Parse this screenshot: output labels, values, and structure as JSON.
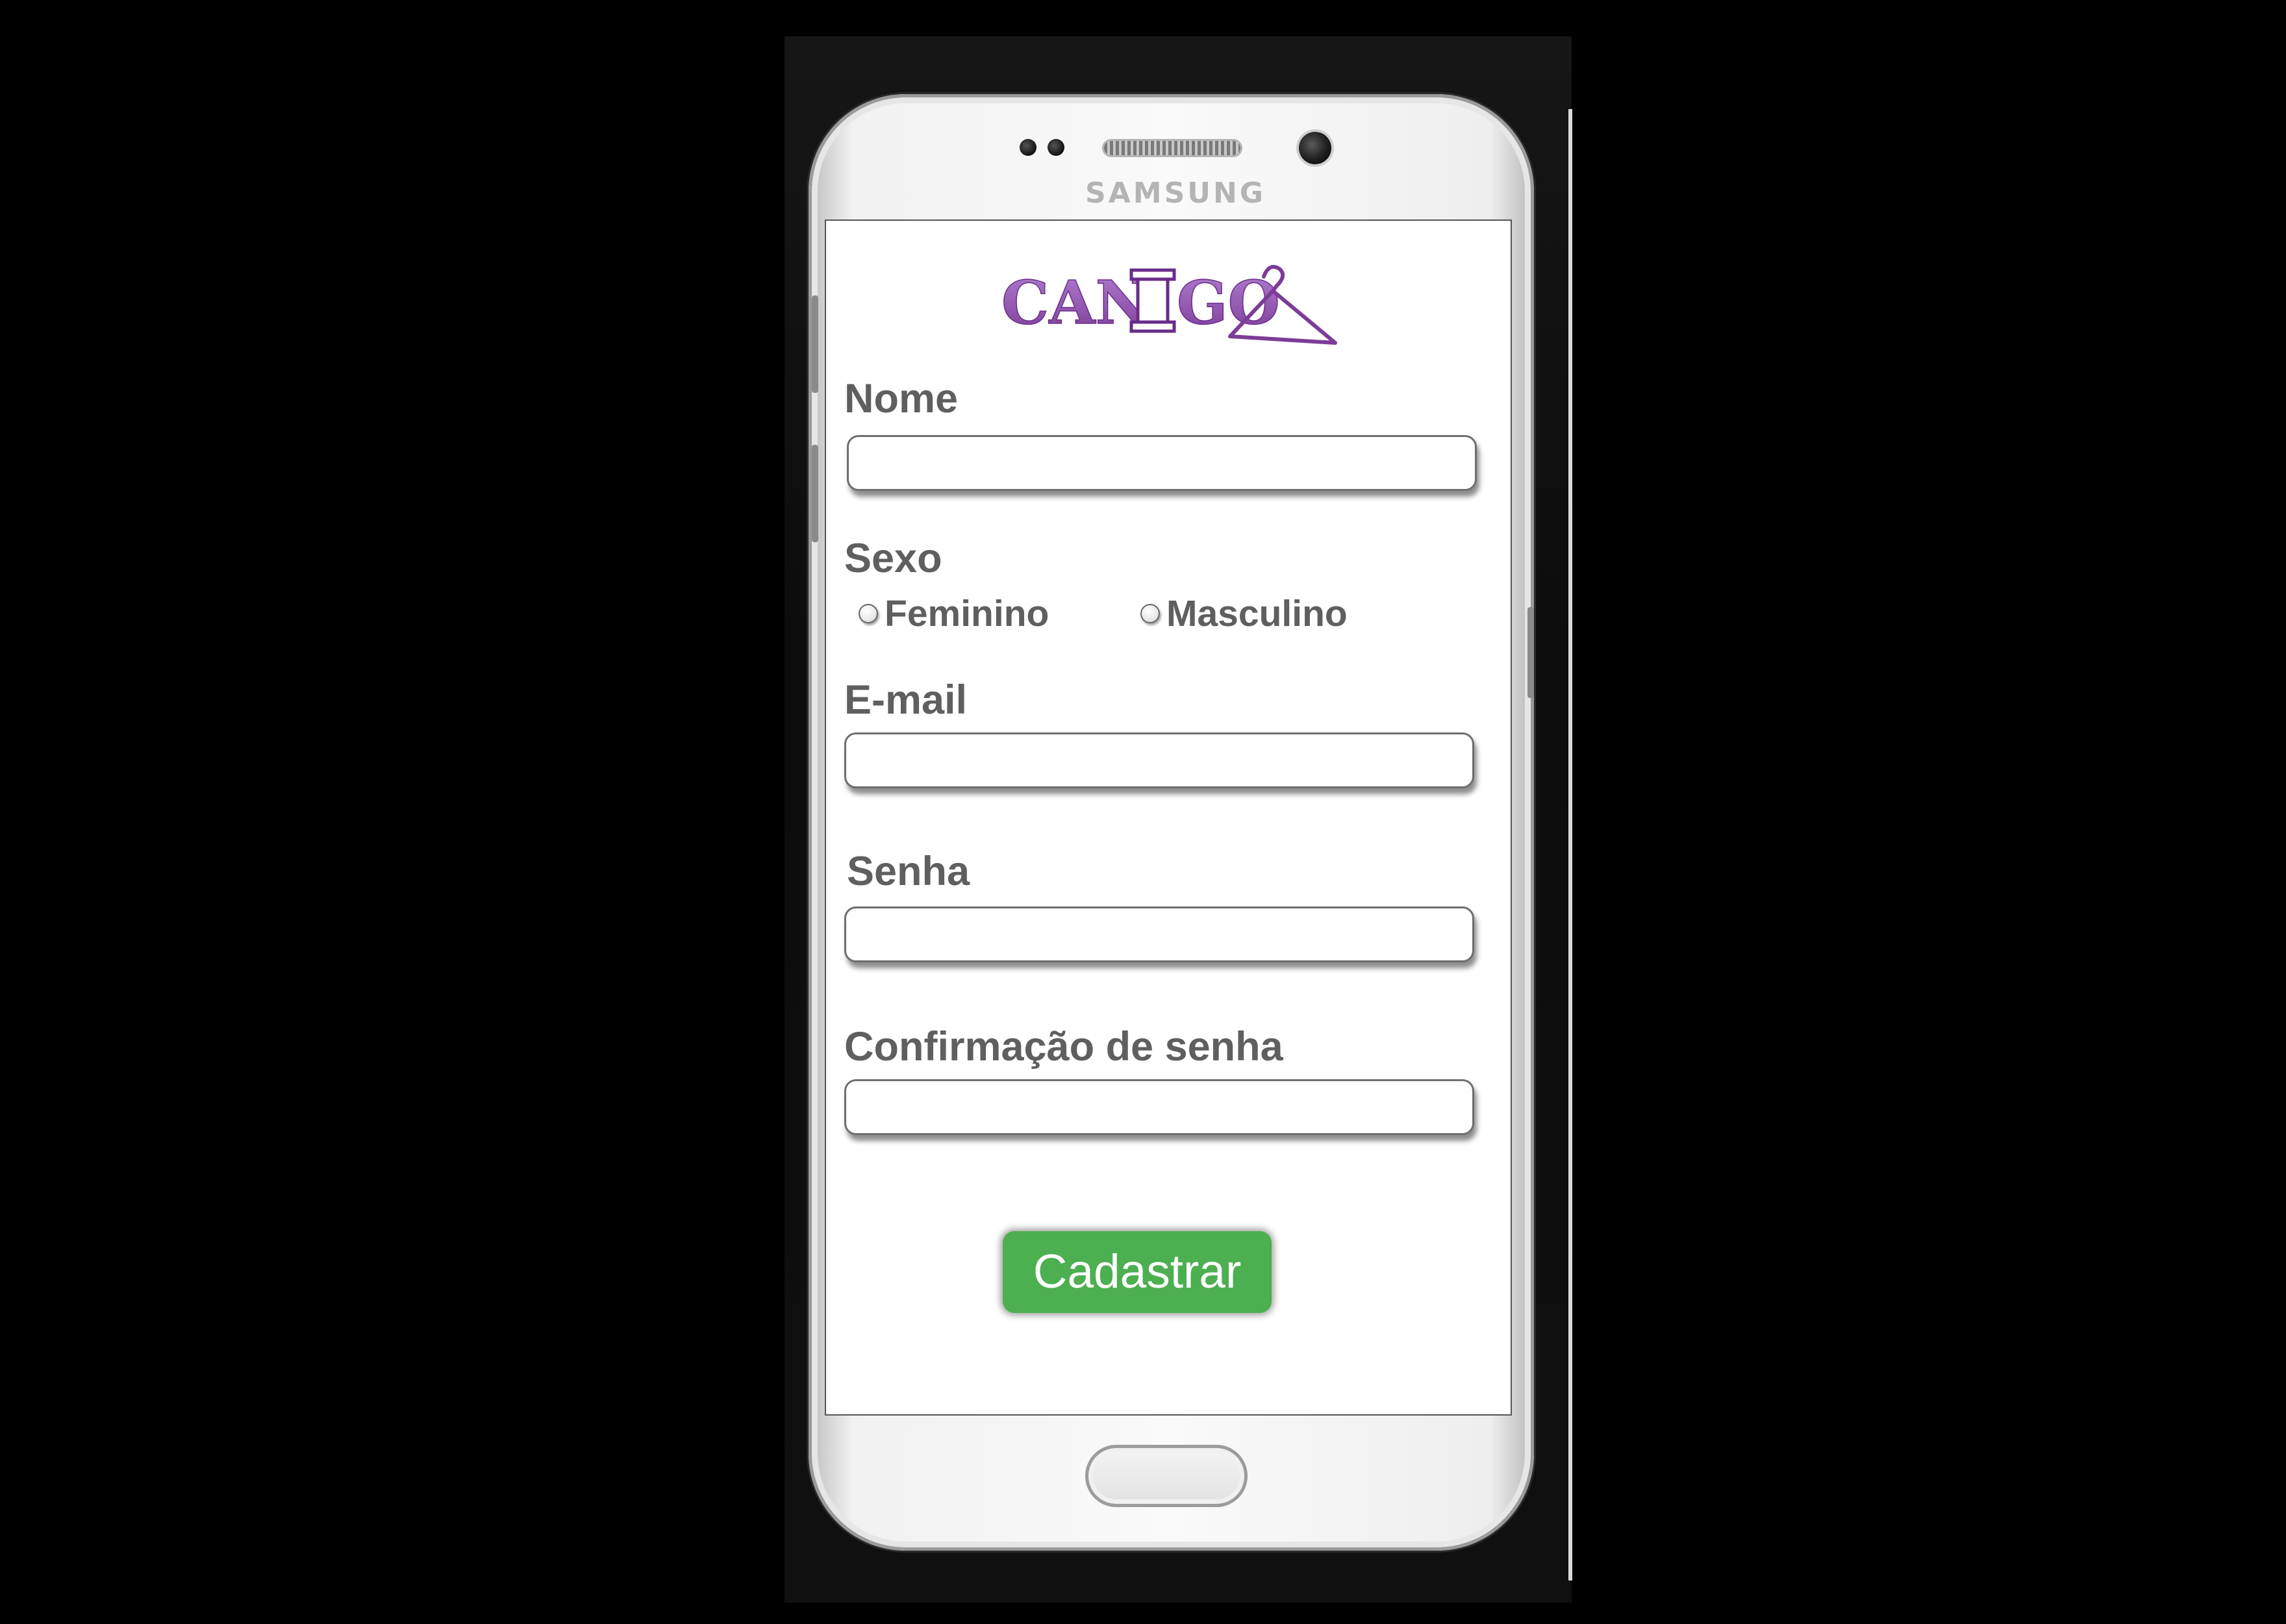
{
  "device": {
    "brand": "SAMSUNG"
  },
  "app": {
    "logo_text": "CANIGO",
    "accent_color": "#8e44ad",
    "button_color": "#4caf50"
  },
  "form": {
    "name": {
      "label": "Nome",
      "value": "",
      "placeholder": ""
    },
    "sex": {
      "label": "Sexo",
      "options": [
        {
          "label": "Feminino",
          "checked": false
        },
        {
          "label": "Masculino",
          "checked": false
        }
      ]
    },
    "email": {
      "label": "E-mail",
      "value": "",
      "placeholder": ""
    },
    "password": {
      "label": "Senha",
      "value": "",
      "placeholder": ""
    },
    "password_confirm": {
      "label": "Confirmação de senha",
      "value": "",
      "placeholder": ""
    },
    "submit_label": "Cadastrar"
  },
  "icons": [
    "hanger-icon",
    "radio-unchecked-icon"
  ]
}
